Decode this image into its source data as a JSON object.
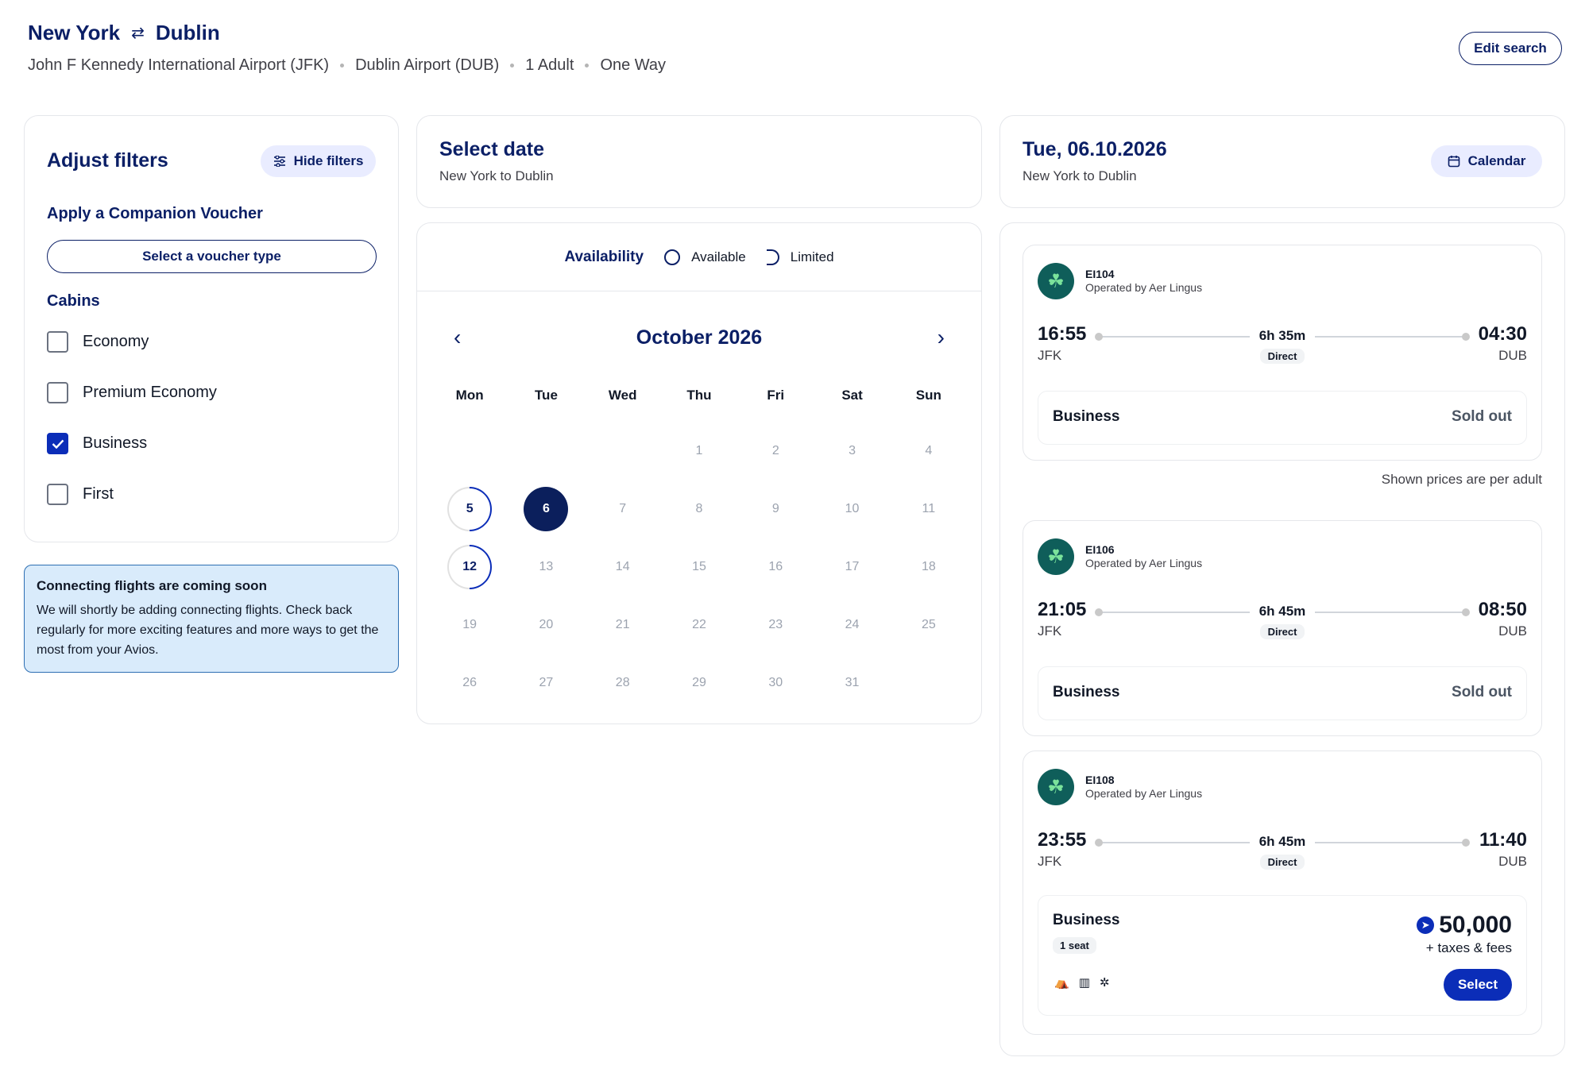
{
  "header": {
    "origin_city": "New York",
    "destination_city": "Dublin",
    "origin_airport": "John F Kennedy International Airport (JFK)",
    "destination_airport": "Dublin Airport (DUB)",
    "passengers": "1 Adult",
    "trip_type": "One Way",
    "edit_label": "Edit search"
  },
  "filters": {
    "title": "Adjust filters",
    "hide_label": "Hide filters",
    "companion_label": "Apply a Companion Voucher",
    "voucher_button": "Select a voucher type",
    "cabins_label": "Cabins",
    "cabins": [
      {
        "label": "Economy",
        "checked": false
      },
      {
        "label": "Premium Economy",
        "checked": false
      },
      {
        "label": "Business",
        "checked": true
      },
      {
        "label": "First",
        "checked": false
      }
    ]
  },
  "notice": {
    "title": "Connecting flights are coming soon",
    "body": "We will shortly be adding connecting flights. Check back regularly for more exciting features and more ways to get the most from your Avios."
  },
  "select_date": {
    "title": "Select date",
    "subtitle": "New York to Dublin"
  },
  "calendar": {
    "availability_label": "Availability",
    "legend_available": "Available",
    "legend_limited": "Limited",
    "month": "October 2026",
    "weekdays": [
      "Mon",
      "Tue",
      "Wed",
      "Thu",
      "Fri",
      "Sat",
      "Sun"
    ],
    "leading_blanks": 3,
    "days": [
      "1",
      "2",
      "3",
      "4",
      "5",
      "6",
      "7",
      "8",
      "9",
      "10",
      "11",
      "12",
      "13",
      "14",
      "15",
      "16",
      "17",
      "18",
      "19",
      "20",
      "21",
      "22",
      "23",
      "24",
      "25",
      "26",
      "27",
      "28",
      "29",
      "30",
      "31"
    ],
    "available_days": [
      "5",
      "12"
    ],
    "selected_day": "6"
  },
  "date_card": {
    "title": "Tue, 06.10.2026",
    "subtitle": "New York to Dublin",
    "calendar_label": "Calendar"
  },
  "results": {
    "per_adult_note": "Shown prices are per adult",
    "flights": [
      {
        "number": "EI104",
        "operator": "Operated by Aer Lingus",
        "dep_time": "16:55",
        "dep_code": "JFK",
        "arr_time": "04:30",
        "arr_code": "DUB",
        "duration": "6h 35m",
        "stops": "Direct",
        "cabin": "Business",
        "status": "Sold out"
      },
      {
        "number": "EI106",
        "operator": "Operated by Aer Lingus",
        "dep_time": "21:05",
        "dep_code": "JFK",
        "arr_time": "08:50",
        "arr_code": "DUB",
        "duration": "6h 45m",
        "stops": "Direct",
        "cabin": "Business",
        "status": "Sold out"
      },
      {
        "number": "EI108",
        "operator": "Operated by Aer Lingus",
        "dep_time": "23:55",
        "dep_code": "JFK",
        "arr_time": "11:40",
        "arr_code": "DUB",
        "duration": "6h 45m",
        "stops": "Direct",
        "cabin": "Business",
        "seats": "1 seat",
        "price": "50,000",
        "taxes": "+ taxes & fees",
        "select_label": "Select"
      }
    ]
  }
}
